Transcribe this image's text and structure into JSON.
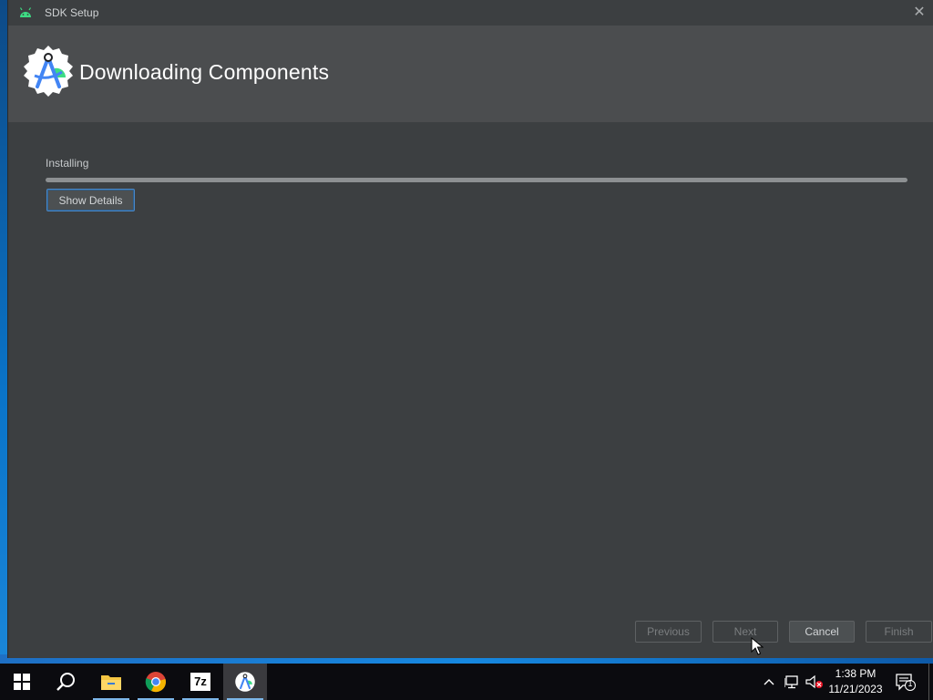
{
  "window": {
    "title": "SDK Setup",
    "close_glyph": "✕",
    "header_title": "Downloading Components",
    "status_label": "Installing",
    "progress_fraction": 1.0,
    "show_details_label": "Show Details",
    "buttons": {
      "previous": "Previous",
      "next": "Next",
      "cancel": "Cancel",
      "finish": "Finish"
    }
  },
  "taskbar": {
    "apps": [
      "start-icon",
      "search-icon",
      "file-explorer-icon",
      "chrome-icon",
      "7zip-icon",
      "android-studio-icon"
    ],
    "sevenzip_label": "7z",
    "clock_time": "1:38 PM",
    "clock_date": "11/21/2023",
    "notification_count": "1"
  },
  "colors": {
    "window_bg": "#3c3f41",
    "header_bg": "#4b4d4f",
    "focus_border": "#4a88c7",
    "taskbar_bg": "#0b0b0f",
    "android_green": "#3ddc84"
  }
}
